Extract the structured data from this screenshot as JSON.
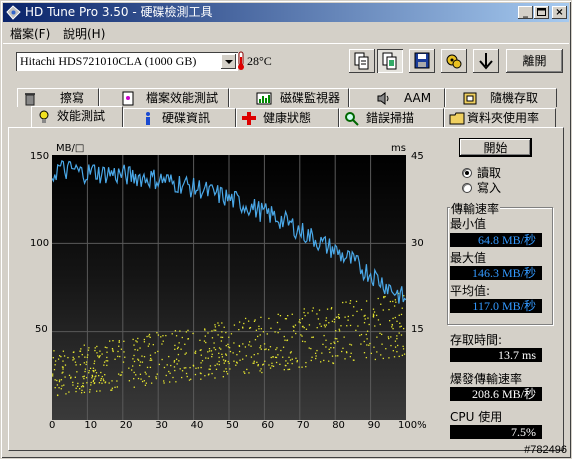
{
  "window": {
    "title": "HD Tune Pro 3.50 - 硬碟檢測工具"
  },
  "menu": {
    "file": "檔案(F)",
    "help": "說明(H)"
  },
  "toolbar": {
    "drive": "Hitachi HDS721010CLA (1000 GB)",
    "temperature": "28°C",
    "exit_label": "離開",
    "icons": [
      "copy-text-icon",
      "copy-screenshot-icon",
      "save-icon",
      "options-icon",
      "download-icon"
    ]
  },
  "tabs_top": [
    {
      "label": "擦寫",
      "icon": "trash-icon"
    },
    {
      "label": "檔案效能測試",
      "icon": "file-benchmark-icon"
    },
    {
      "label": "磁碟監視器",
      "icon": "monitor-icon"
    },
    {
      "label": "AAM",
      "icon": "speaker-icon"
    },
    {
      "label": "隨機存取",
      "icon": "random-access-icon"
    }
  ],
  "tabs_bottom": [
    {
      "label": "效能測試",
      "icon": "benchmark-icon",
      "active": true
    },
    {
      "label": "硬碟資訊",
      "icon": "info-icon"
    },
    {
      "label": "健康狀態",
      "icon": "health-icon"
    },
    {
      "label": "錯誤掃描",
      "icon": "magnifier-icon"
    },
    {
      "label": "資料夾使用率",
      "icon": "folder-icon"
    }
  ],
  "controls": {
    "start_label": "開始",
    "read_label": "讀取",
    "write_label": "寫入",
    "mode": "read"
  },
  "stats": {
    "group_title": "傳輸速率",
    "min_label": "最小值",
    "min_value": "64.8 MB/秒",
    "max_label": "最大值",
    "max_value": "146.3 MB/秒",
    "avg_label": "平均值:",
    "avg_value": "117.0 MB/秒",
    "access_label": "存取時間:",
    "access_value": "13.7 ms",
    "burst_label": "爆發傳輸速率",
    "burst_value": "208.6 MB/秒",
    "cpu_label": "CPU 使用",
    "cpu_value": "7.5%"
  },
  "footer": {
    "watermark": "#782496"
  },
  "colors": {
    "transfer_line": "#4aa8e8",
    "access_dots": "#e8e830",
    "value_text": "#3399ff"
  },
  "chart_data": {
    "type": "line",
    "y_left_unit": "MB/□",
    "y_right_unit": "ms",
    "x_ticks": [
      "0",
      "10",
      "20",
      "30",
      "40",
      "50",
      "60",
      "70",
      "80",
      "90",
      "100%"
    ],
    "y_left_ticks": [
      "150",
      "100",
      "50"
    ],
    "y_right_ticks": [
      "45",
      "30",
      "15"
    ],
    "ylim_left": [
      0,
      150
    ],
    "ylim_right": [
      0,
      45
    ],
    "xlim": [
      0,
      100
    ],
    "series": [
      {
        "name": "transfer",
        "x": [
          0,
          2,
          4,
          6,
          8,
          10,
          12,
          14,
          16,
          18,
          20,
          22,
          24,
          26,
          28,
          30,
          32,
          34,
          36,
          38,
          40,
          42,
          44,
          46,
          48,
          50,
          52,
          54,
          56,
          58,
          60,
          62,
          64,
          66,
          68,
          70,
          72,
          74,
          76,
          78,
          80,
          82,
          84,
          86,
          88,
          90,
          92,
          94,
          96,
          98,
          100
        ],
        "y": [
          138,
          143,
          141,
          142,
          140,
          140,
          141,
          139,
          140,
          139,
          139,
          138,
          138,
          137,
          137,
          136,
          136,
          134,
          134,
          133,
          131,
          131,
          129,
          128,
          127,
          125,
          124,
          122,
          121,
          119,
          117,
          116,
          114,
          112,
          110,
          107,
          105,
          103,
          100,
          98,
          96,
          93,
          91,
          88,
          85,
          83,
          80,
          77,
          74,
          71,
          68
        ]
      },
      {
        "name": "access",
        "note_type": "scatter",
        "x_range": [
          0,
          100
        ],
        "y_range_ms": [
          4,
          24
        ]
      }
    ]
  }
}
